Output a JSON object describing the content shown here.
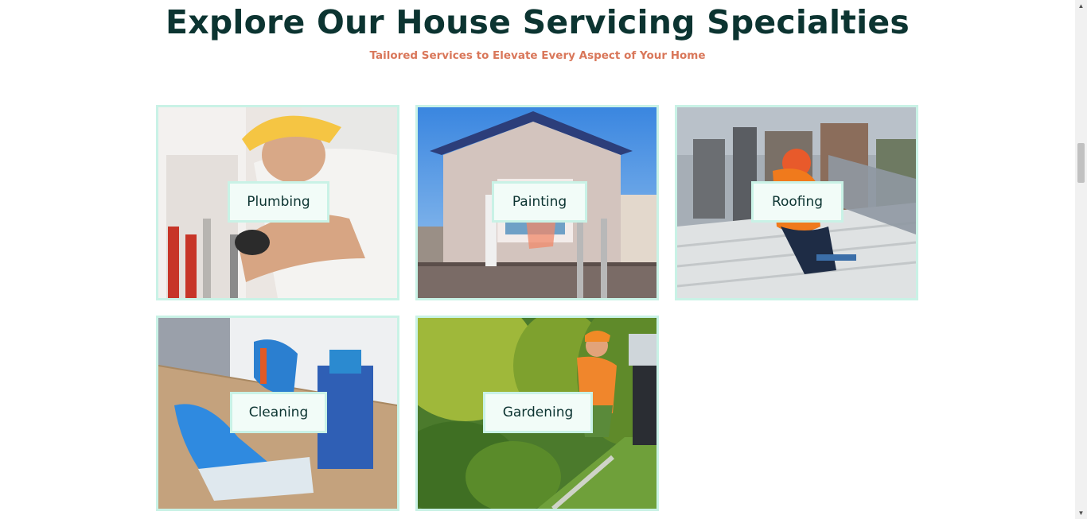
{
  "section": {
    "title": "Explore Our House Servicing Specialties",
    "subtitle": "Tailored Services to Elevate Every Aspect of Your Home"
  },
  "services": [
    {
      "label": "Plumbing"
    },
    {
      "label": "Painting"
    },
    {
      "label": "Roofing"
    },
    {
      "label": "Cleaning"
    },
    {
      "label": "Gardening"
    }
  ],
  "colors": {
    "heading": "#0c3431",
    "subtitle": "#d9775a",
    "card_border": "#c9f2e6",
    "label_bg": "#f2fcf8"
  },
  "scrollbar": {
    "up_icon": "triangle-up-icon",
    "down_icon": "triangle-down-icon"
  }
}
